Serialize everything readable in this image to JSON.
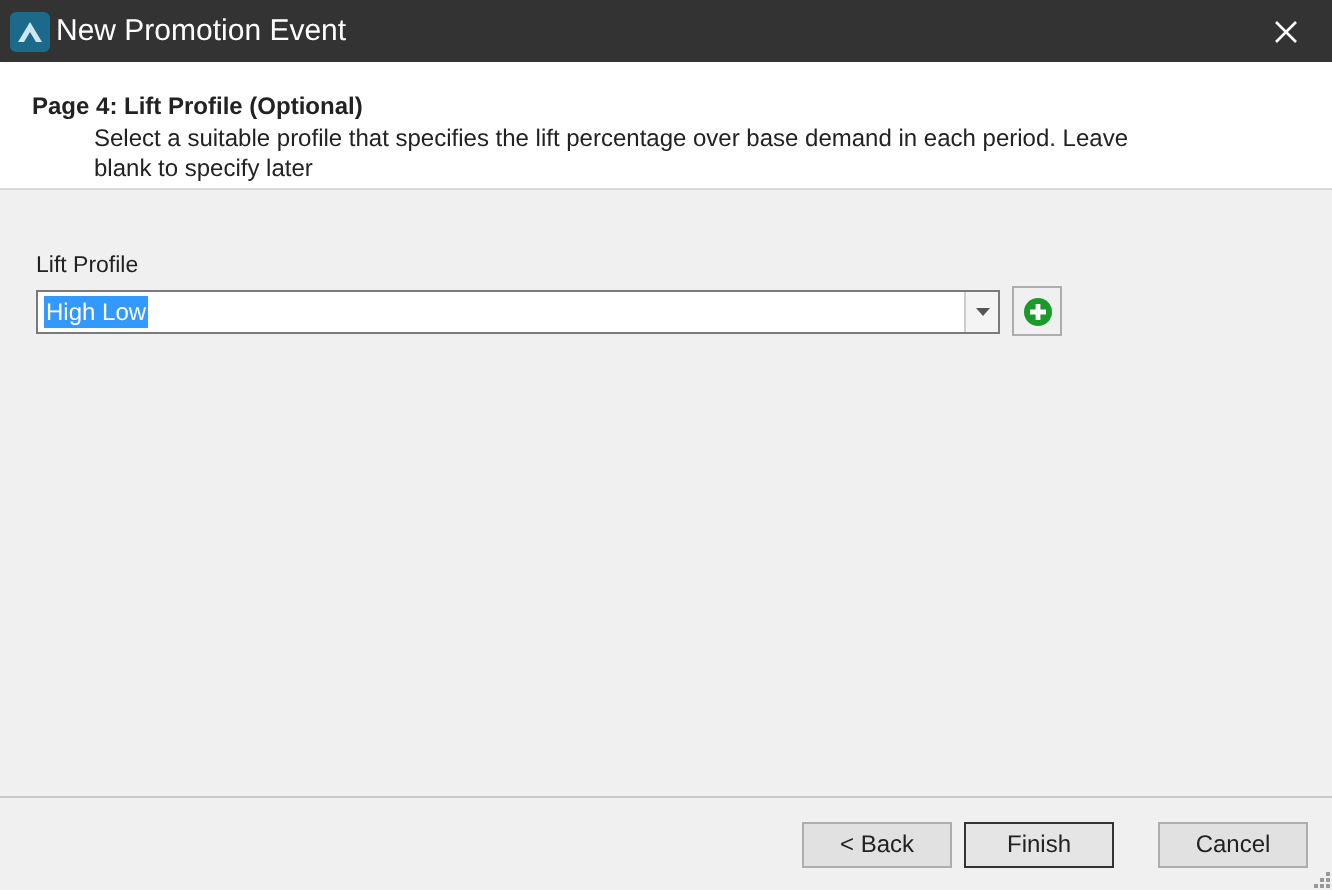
{
  "window": {
    "title": "New Promotion Event"
  },
  "header": {
    "title": "Page 4: Lift Profile (Optional)",
    "description": "Select a suitable profile that specifies the lift percentage over base demand in each period. Leave blank to specify later"
  },
  "lift_profile": {
    "label": "Lift Profile",
    "value": "High Low",
    "text_selected": true
  },
  "buttons": [
    {
      "label": "< Back",
      "default": false
    },
    {
      "label": "Finish",
      "default": true
    },
    {
      "label": "Cancel",
      "default": false
    }
  ]
}
